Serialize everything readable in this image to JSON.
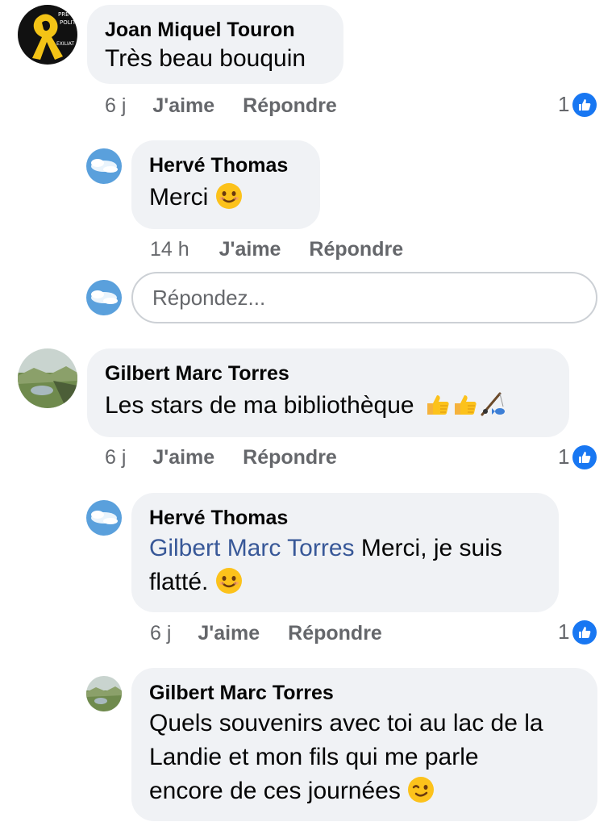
{
  "comments": [
    {
      "author": "Joan Miquel Touron",
      "text": "Très beau bouquin",
      "time": "6 j",
      "like_label": "J'aime",
      "reply_label": "Répondre",
      "like_count": "1",
      "avatar_text": [
        "PRE",
        "POLIT",
        "EXILIAT"
      ]
    },
    {
      "author": "Hervé Thomas",
      "text": "Merci",
      "time": "14 h",
      "like_label": "J'aime",
      "reply_label": "Répondre"
    },
    {
      "author": "Gilbert Marc Torres",
      "text": "Les stars de ma bibliothèque",
      "time": "6 j",
      "like_label": "J'aime",
      "reply_label": "Répondre",
      "like_count": "1"
    },
    {
      "author": "Hervé Thomas",
      "mention": "Gilbert Marc Torres",
      "text_line1": "Merci, je suis",
      "text_line2": "flatté.",
      "time": "6 j",
      "like_label": "J'aime",
      "reply_label": "Répondre",
      "like_count": "1"
    },
    {
      "author": "Gilbert Marc Torres",
      "text_lines": [
        "Quels souvenirs avec toi au lac de la",
        "Landie et mon fils qui me parle",
        "encore de ces journées"
      ]
    }
  ],
  "reply_box": {
    "placeholder": "Répondez..."
  },
  "colors": {
    "bubble": "#f0f2f5",
    "like_blue": "#1877f2",
    "mention": "#385898",
    "meta": "#65676b"
  }
}
